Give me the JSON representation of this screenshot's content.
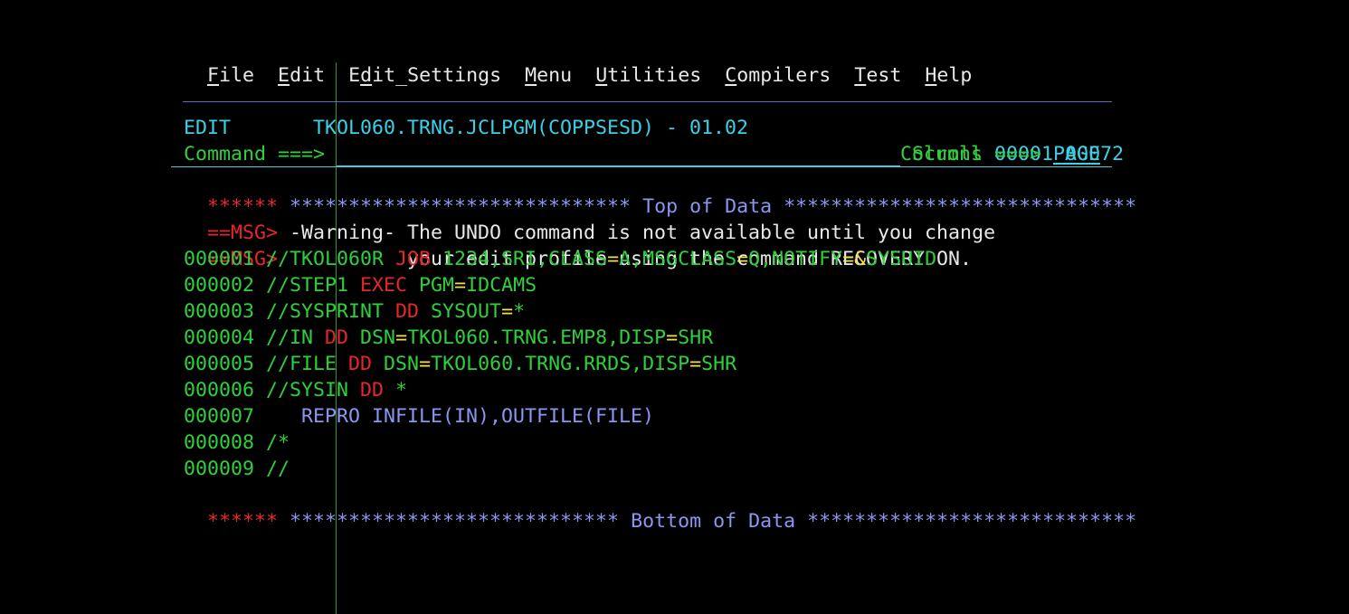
{
  "colors": {
    "background": "#000000",
    "turquoise": "#3ad1e6",
    "green": "#2fd03b",
    "red": "#e8262a",
    "blue": "#8a96f0",
    "white": "#e8e8e8",
    "yellow": "#f0e04a",
    "separator": "#5a6acc"
  },
  "menu": {
    "items": [
      {
        "hotkey": "F",
        "rest": "ile"
      },
      {
        "hotkey": "E",
        "rest": "dit"
      },
      {
        "pre": "E",
        "hotkey": "d",
        "rest": "it_Settings"
      },
      {
        "hotkey": "M",
        "rest": "enu"
      },
      {
        "hotkey": "U",
        "rest": "tilities"
      },
      {
        "hotkey": "C",
        "rest": "ompilers"
      },
      {
        "hotkey": "T",
        "rest": "est"
      },
      {
        "hotkey": "H",
        "rest": "elp"
      }
    ]
  },
  "header": {
    "mode": "EDIT",
    "dataset": "TKOL060.TRNG.JCLPGM(COPPSESD) - 01.02",
    "columns_label": "Columns",
    "col_start": "00001",
    "col_end": "00072",
    "command_label": "Command ===>",
    "command_value": "",
    "scroll_label": "Scroll ===>",
    "scroll_value": "PAGE"
  },
  "top_marker": {
    "prefix": "******",
    "stars_left": "*****************************",
    "text": " Top of Data ",
    "stars_right": "******************************"
  },
  "messages": [
    {
      "prefix": "==MSG>",
      "text": " -Warning- The UNDO command is not available until you change"
    },
    {
      "prefix": "==MSG>",
      "text": "           your edit profile using the command RECOVERY ON."
    }
  ],
  "lines": [
    {
      "num": "000001",
      "segs": [
        {
          "t": " //TKOL060R ",
          "c": "green"
        },
        {
          "t": "JOB",
          "c": "red"
        },
        {
          "t": " 1234,SRI,CLASS",
          "c": "green"
        },
        {
          "t": "=",
          "c": "yellow"
        },
        {
          "t": "A,MSGCLASS",
          "c": "green"
        },
        {
          "t": "=",
          "c": "yellow"
        },
        {
          "t": "Q,NOTIFY",
          "c": "green"
        },
        {
          "t": "=&",
          "c": "yellow"
        },
        {
          "t": "SYSUID",
          "c": "green"
        }
      ]
    },
    {
      "num": "000002",
      "segs": [
        {
          "t": " //STEP1 ",
          "c": "green"
        },
        {
          "t": "EXEC",
          "c": "red"
        },
        {
          "t": " PGM",
          "c": "green"
        },
        {
          "t": "=",
          "c": "yellow"
        },
        {
          "t": "IDCAMS",
          "c": "green"
        }
      ]
    },
    {
      "num": "000003",
      "segs": [
        {
          "t": " //SYSPRINT ",
          "c": "green"
        },
        {
          "t": "DD",
          "c": "red"
        },
        {
          "t": " SYSOUT",
          "c": "green"
        },
        {
          "t": "=",
          "c": "yellow"
        },
        {
          "t": "*",
          "c": "green"
        }
      ]
    },
    {
      "num": "000004",
      "segs": [
        {
          "t": " //IN ",
          "c": "green"
        },
        {
          "t": "DD",
          "c": "red"
        },
        {
          "t": " DSN",
          "c": "green"
        },
        {
          "t": "=",
          "c": "yellow"
        },
        {
          "t": "TKOL060.TRNG.EMP8,DISP",
          "c": "green"
        },
        {
          "t": "=",
          "c": "yellow"
        },
        {
          "t": "SHR",
          "c": "green"
        }
      ]
    },
    {
      "num": "000005",
      "segs": [
        {
          "t": " //FILE ",
          "c": "green"
        },
        {
          "t": "DD",
          "c": "red"
        },
        {
          "t": " DSN",
          "c": "green"
        },
        {
          "t": "=",
          "c": "yellow"
        },
        {
          "t": "TKOL060.TRNG.RRDS,DISP",
          "c": "green"
        },
        {
          "t": "=",
          "c": "yellow"
        },
        {
          "t": "SHR",
          "c": "green"
        }
      ]
    },
    {
      "num": "000006",
      "segs": [
        {
          "t": " //SYSIN ",
          "c": "green"
        },
        {
          "t": "DD",
          "c": "red"
        },
        {
          "t": " *",
          "c": "green"
        }
      ]
    },
    {
      "num": "000007",
      "segs": [
        {
          "t": "    REPRO INFILE(IN),OUTFILE(FILE)",
          "c": "blue"
        }
      ]
    },
    {
      "num": "000008",
      "segs": [
        {
          "t": " /*",
          "c": "green"
        }
      ]
    },
    {
      "num": "000009",
      "segs": [
        {
          "t": " //",
          "c": "green"
        }
      ]
    }
  ],
  "bottom_marker": {
    "prefix": "******",
    "stars_left": "****************************",
    "text": " Bottom of Data ",
    "stars_right": "****************************"
  }
}
